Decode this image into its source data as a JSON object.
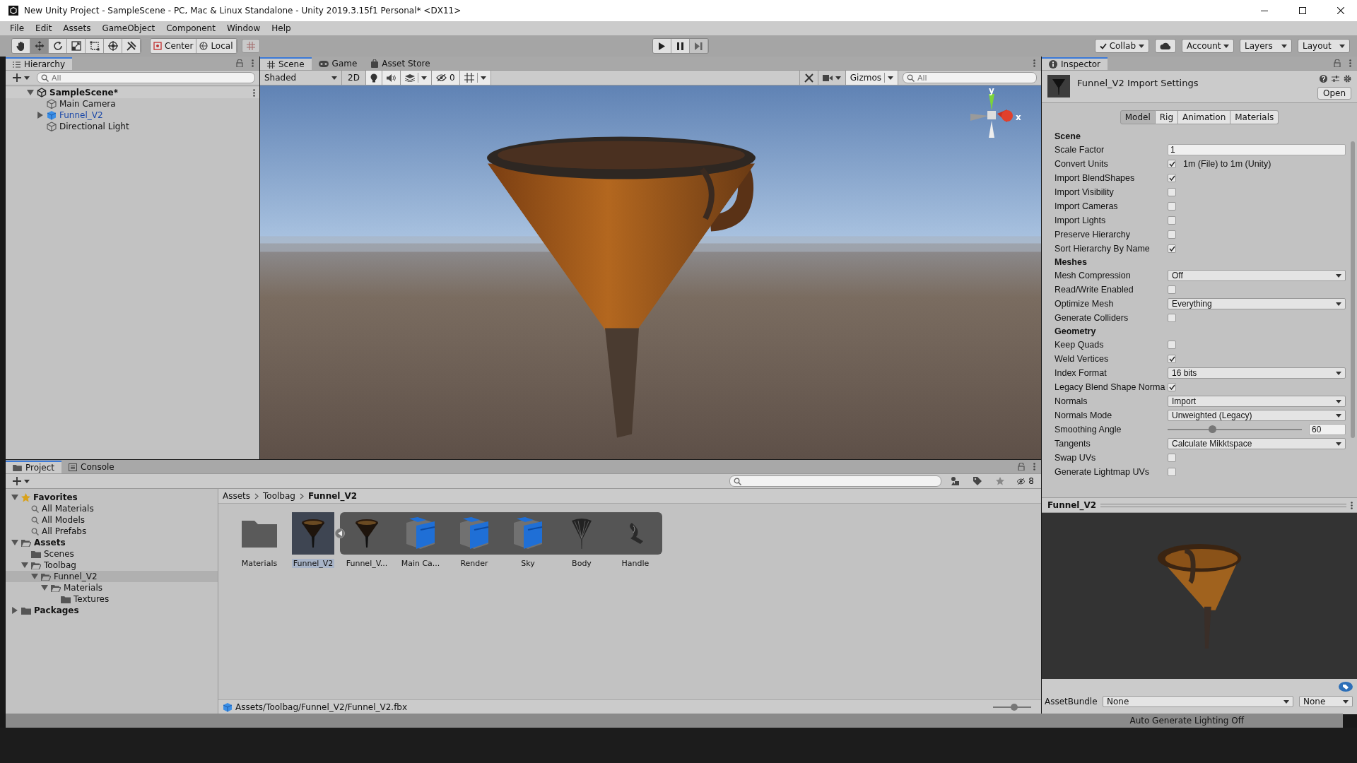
{
  "window": {
    "title": "New Unity Project - SampleScene - PC, Mac & Linux Standalone - Unity 2019.3.15f1 Personal* <DX11>"
  },
  "menu": [
    "File",
    "Edit",
    "Assets",
    "GameObject",
    "Component",
    "Window",
    "Help"
  ],
  "toolbar": {
    "tools": [
      {
        "kind": "hand",
        "selected": false
      },
      {
        "kind": "move",
        "selected": true
      },
      {
        "kind": "rotate",
        "selected": false
      },
      {
        "kind": "scale",
        "selected": false
      },
      {
        "kind": "rect",
        "selected": false
      },
      {
        "kind": "transform",
        "selected": false
      },
      {
        "kind": "custom",
        "selected": false
      }
    ],
    "pivot": [
      "Center",
      "Local"
    ],
    "collab": "Collab",
    "account": "Account",
    "layers": "Layers",
    "layout": "Layout"
  },
  "hierarchy": {
    "tab": "Hierarchy",
    "search": {
      "placeholder": "All"
    },
    "items": [
      {
        "label": "SampleScene*",
        "kind": "scene",
        "expanded": true,
        "children": [
          {
            "label": "Main Camera",
            "kind": "object"
          },
          {
            "label": "Funnel_V2",
            "kind": "prefab",
            "expanded": false
          },
          {
            "label": "Directional Light",
            "kind": "object"
          }
        ]
      }
    ]
  },
  "scene_view": {
    "tabs": [
      {
        "label": "Scene",
        "kind": "scene",
        "selected": true
      },
      {
        "label": "Game",
        "kind": "game",
        "selected": false
      },
      {
        "label": "Asset Store",
        "kind": "store",
        "selected": false
      }
    ],
    "draw_mode": "Shaded",
    "mode_2d": "2D",
    "hidden_count": "0",
    "gizmos": "Gizmos",
    "search": {
      "placeholder": "All"
    },
    "axis_labels": [
      "y",
      "x"
    ]
  },
  "inspector": {
    "tab": "Inspector",
    "title": "Funnel_V2 Import Settings",
    "open_button": "Open",
    "tabs": [
      {
        "label": "Model",
        "selected": true
      },
      {
        "label": "Rig",
        "selected": false
      },
      {
        "label": "Animation",
        "selected": false
      },
      {
        "label": "Materials",
        "selected": false
      }
    ],
    "rows": [
      {
        "kind": "header",
        "label": "Scene"
      },
      {
        "kind": "text",
        "label": "Scale Factor",
        "value": "1"
      },
      {
        "kind": "checkbox",
        "label": "Convert Units",
        "checked": true,
        "note": "1m (File) to 1m (Unity)"
      },
      {
        "kind": "checkbox",
        "label": "Import BlendShapes",
        "checked": true
      },
      {
        "kind": "checkbox",
        "label": "Import Visibility",
        "checked": false
      },
      {
        "kind": "checkbox",
        "label": "Import Cameras",
        "checked": false
      },
      {
        "kind": "checkbox",
        "label": "Import Lights",
        "checked": false
      },
      {
        "kind": "checkbox",
        "label": "Preserve Hierarchy",
        "checked": false
      },
      {
        "kind": "checkbox",
        "label": "Sort Hierarchy By Name",
        "checked": true
      },
      {
        "kind": "header",
        "label": "Meshes"
      },
      {
        "kind": "dropdown",
        "label": "Mesh Compression",
        "value": "Off"
      },
      {
        "kind": "checkbox",
        "label": "Read/Write Enabled",
        "checked": false
      },
      {
        "kind": "dropdown",
        "label": "Optimize Mesh",
        "value": "Everything"
      },
      {
        "kind": "checkbox",
        "label": "Generate Colliders",
        "checked": false
      },
      {
        "kind": "header",
        "label": "Geometry"
      },
      {
        "kind": "checkbox",
        "label": "Keep Quads",
        "checked": false
      },
      {
        "kind": "checkbox",
        "label": "Weld Vertices",
        "checked": true
      },
      {
        "kind": "dropdown",
        "label": "Index Format",
        "value": "16 bits"
      },
      {
        "kind": "checkbox",
        "label": "Legacy Blend Shape Norma",
        "checked": true
      },
      {
        "kind": "dropdown",
        "label": "Normals",
        "value": "Import"
      },
      {
        "kind": "dropdown",
        "label": "Normals Mode",
        "value": "Unweighted (Legacy)"
      },
      {
        "kind": "slider",
        "label": "Smoothing Angle",
        "level": 0.333,
        "value": "60"
      },
      {
        "kind": "dropdown",
        "label": "Tangents",
        "value": "Calculate Mikktspace"
      },
      {
        "kind": "checkbox",
        "label": "Swap UVs",
        "checked": false
      },
      {
        "kind": "checkbox",
        "label": "Generate Lightmap UVs",
        "checked": false
      }
    ],
    "preview_title": "Funnel_V2",
    "asset_bundle": {
      "label": "AssetBundle",
      "name": "None",
      "variant": "None"
    }
  },
  "project": {
    "tabs": [
      {
        "label": "Project",
        "kind": "project",
        "selected": true
      },
      {
        "label": "Console",
        "kind": "console",
        "selected": false
      }
    ],
    "hidden_count": "8",
    "tree": [
      {
        "label": "Favorites",
        "kind": "favorites",
        "expanded": true,
        "selected": false,
        "children": [
          {
            "label": "All Materials",
            "kind": "search",
            "selected": false
          },
          {
            "label": "All Models",
            "kind": "search",
            "selected": false
          },
          {
            "label": "All Prefabs",
            "kind": "search",
            "selected": false
          }
        ]
      },
      {
        "label": "Assets",
        "kind": "root",
        "expanded": true,
        "selected": false,
        "children": [
          {
            "label": "Scenes",
            "kind": "folder",
            "selected": false
          },
          {
            "label": "Toolbag",
            "kind": "folder",
            "expanded": true,
            "selected": false,
            "children": [
              {
                "label": "Funnel_V2",
                "kind": "folder",
                "expanded": true,
                "selected": true,
                "children": [
                  {
                    "label": "Materials",
                    "kind": "folder",
                    "expanded": true,
                    "selected": false,
                    "children": [
                      {
                        "label": "Textures",
                        "kind": "folder",
                        "selected": false
                      }
                    ]
                  }
                ]
              }
            ]
          }
        ]
      },
      {
        "label": "Packages",
        "kind": "root",
        "expanded": false,
        "selected": false
      }
    ],
    "breadcrumb": [
      "Assets",
      "Toolbag",
      "Funnel_V2"
    ],
    "assets": [
      {
        "label": "Materials",
        "kind": "folder",
        "selected": false
      },
      {
        "label": "Funnel_V2",
        "kind": "model",
        "selected": true,
        "expanded": true
      },
      {
        "label": "Funnel_V...",
        "kind": "sub_model",
        "selected": false
      },
      {
        "label": "Main Ca...",
        "kind": "sub_object",
        "selected": false
      },
      {
        "label": "Render",
        "kind": "sub_object",
        "selected": false
      },
      {
        "label": "Sky",
        "kind": "sub_object",
        "selected": false
      },
      {
        "label": "Body",
        "kind": "sub_body",
        "selected": false
      },
      {
        "label": "Handle",
        "kind": "sub_handle",
        "selected": false
      }
    ],
    "path": "Assets/Toolbag/Funnel_V2/Funnel_V2.fbx",
    "zoom_slider": {
      "level": 0.55
    }
  },
  "status_bar": {
    "text": "Auto Generate Lighting Off"
  }
}
